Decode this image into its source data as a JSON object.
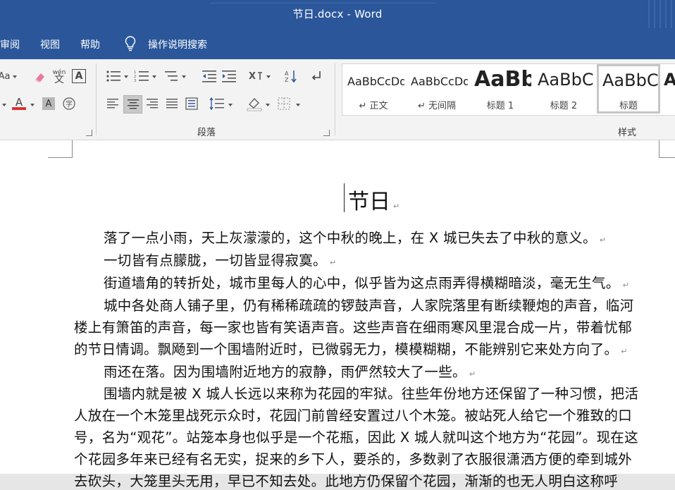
{
  "window": {
    "title": "节日.docx  -  Word"
  },
  "menu": {
    "items": [
      "审阅",
      "视图",
      "帮助"
    ],
    "tell_me": "操作说明搜索"
  },
  "ribbon": {
    "paragraph_label": "段落",
    "styles_label": "样式",
    "font_icons": {
      "pinyin": "wén",
      "pinyin_sub": "文"
    },
    "styles": [
      {
        "sample": "AaBbCcDd",
        "name": "↵ 正文"
      },
      {
        "sample": "AaBbCcDd",
        "name": "↵ 无间隔"
      },
      {
        "sample": "AaBb",
        "name": "标题 1"
      },
      {
        "sample": "AaBbC",
        "name": "标题 2"
      },
      {
        "sample": "AaBbC",
        "name": "标题"
      },
      {
        "sample": "A",
        "name": ""
      }
    ]
  },
  "colors": {
    "accent": "#2b579a",
    "font_color": "#e03030"
  },
  "document": {
    "title": "节日",
    "lines": [
      "落了一点小雨，天上灰濛濛的，这个中秋的晚上，在 X 城已失去了中秋的意义。",
      "一切皆有点朦胧，一切皆显得寂寞。",
      "街道墙角的转折处，城市里每人的心中，似乎皆为这点雨弄得横糊暗淡，毫无生气。",
      "城中各处商人铺子里，仍有稀稀疏疏的锣鼓声音，人家院落里有断续鞭炮的声音，临河",
      "楼上有箫笛的声音，每一家也皆有笑语声音。这些声音在细雨寒风里混合成一片，带着忧郁",
      "的节日情调。飘飏到一个围墙附近时，已微弱无力，模模糊糊，不能辨别它来处方向了。",
      "雨还在落。因为围墙附近地方的寂静，雨俨然较大了一些。",
      "围墙内就是被 X 城人长远以来称为花园的牢狱。往些年份地方还保留了一种习惯，把活",
      "人放在一个木笼里战死示众时，花园门前曾经安置过八个木笼。被站死人给它一个雅致的口",
      "号，名为“观花”。站笼本身也似乎是一个花瓶，因此 X 城人就叫这个地方为“花园”。现在这",
      "个花园多年来已经有名无实，捉来的乡下人，要杀的，多数剥了衣服很潇洒方便的牵到城外",
      "去砍头，大笼里头无用，早已不知去处。此地方仍保留个花园，渐渐的也无人明白这称呼"
    ]
  }
}
